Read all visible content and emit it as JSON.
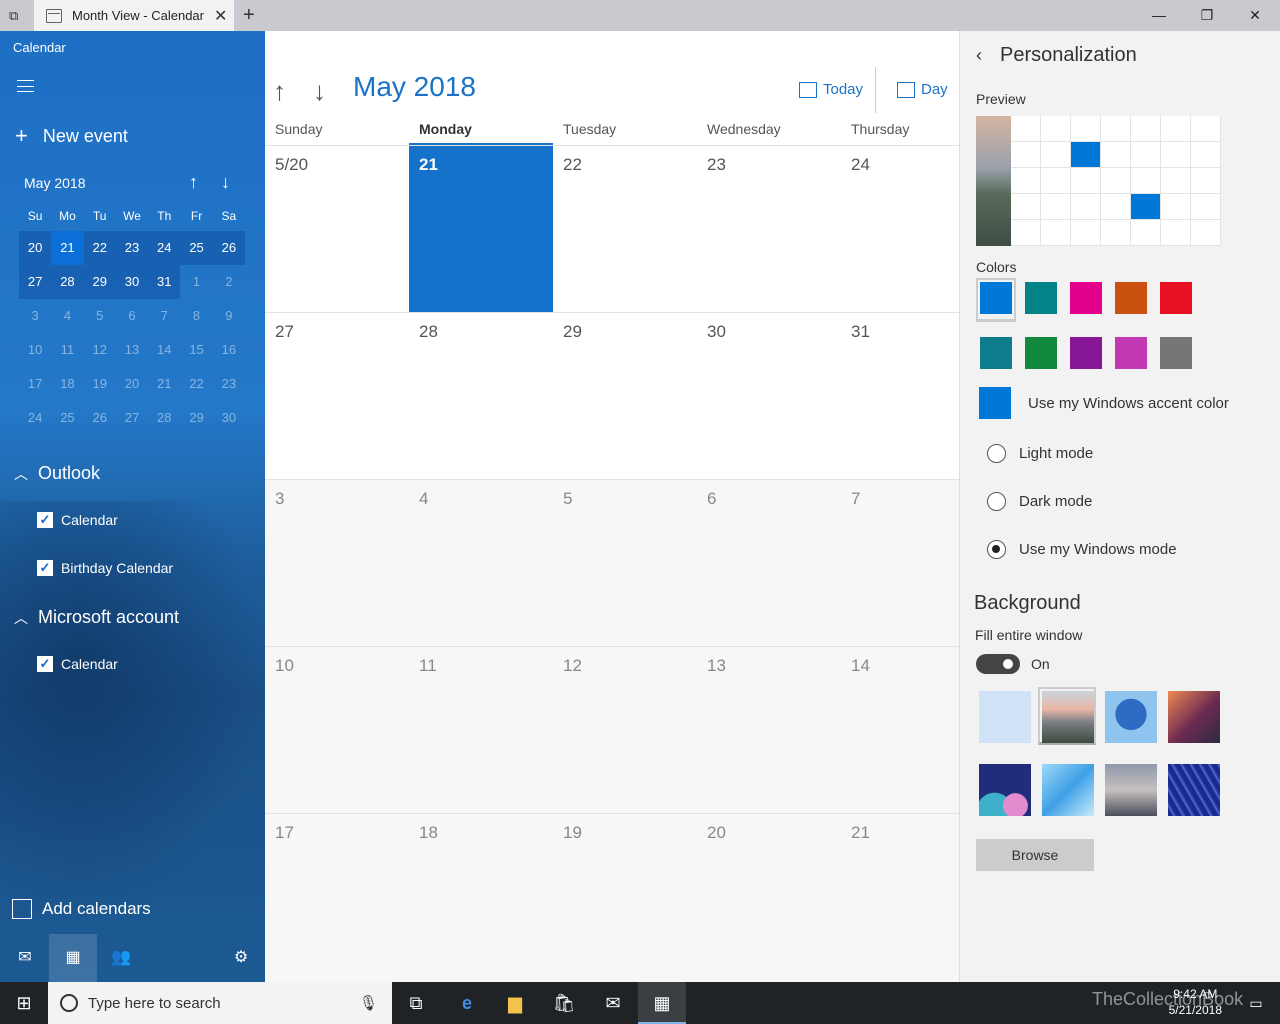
{
  "window": {
    "tab_title": "Month View - Calendar",
    "close": "✕",
    "new_tab": "+",
    "min": "—",
    "restore": "❐",
    "close_win": "✕"
  },
  "sidebar": {
    "app_name": "Calendar",
    "new_event": "New event",
    "mini": {
      "title": "May 2018",
      "dow": [
        "Su",
        "Mo",
        "Tu",
        "We",
        "Th",
        "Fr",
        "Sa"
      ],
      "weeks": [
        [
          "20",
          "21",
          "22",
          "23",
          "24",
          "25",
          "26"
        ],
        [
          "27",
          "28",
          "29",
          "30",
          "31",
          "1",
          "2"
        ],
        [
          "3",
          "4",
          "5",
          "6",
          "7",
          "8",
          "9"
        ],
        [
          "10",
          "11",
          "12",
          "13",
          "14",
          "15",
          "16"
        ],
        [
          "17",
          "18",
          "19",
          "20",
          "21",
          "22",
          "23"
        ],
        [
          "24",
          "25",
          "26",
          "27",
          "28",
          "29",
          "30"
        ]
      ]
    },
    "groups": [
      {
        "name": "Outlook",
        "items": [
          "Calendar",
          "Birthday Calendar"
        ]
      },
      {
        "name": "Microsoft account",
        "items": [
          "Calendar"
        ]
      }
    ],
    "add_calendars": "Add calendars"
  },
  "main": {
    "month_title": "May 2018",
    "today_label": "Today",
    "day_label": "Day",
    "dow": [
      "Sunday",
      "Monday",
      "Tuesday",
      "Wednesday",
      "Thursday"
    ],
    "weeks": [
      [
        "5/20",
        "21",
        "22",
        "23",
        "24"
      ],
      [
        "27",
        "28",
        "29",
        "30",
        "31"
      ],
      [
        "3",
        "4",
        "5",
        "6",
        "7"
      ],
      [
        "10",
        "11",
        "12",
        "13",
        "14"
      ],
      [
        "17",
        "18",
        "19",
        "20",
        "21"
      ]
    ]
  },
  "pane": {
    "title": "Personalization",
    "preview_label": "Preview",
    "colors_label": "Colors",
    "colors": [
      "#0078d7",
      "#038387",
      "#e3008c",
      "#ca5010",
      "#e81123",
      "#0f7c8c",
      "#10893e",
      "#881798",
      "#c239b3",
      "#767676"
    ],
    "accent_label": "Use my Windows accent color",
    "modes": [
      "Light mode",
      "Dark mode",
      "Use my Windows mode"
    ],
    "background_title": "Background",
    "fill_label": "Fill entire window",
    "toggle_state": "On",
    "browse": "Browse"
  },
  "taskbar": {
    "search_placeholder": "Type here to search",
    "time": "9:42 AM",
    "date": "5/21/2018",
    "watermark": "TheCollectionBook"
  }
}
